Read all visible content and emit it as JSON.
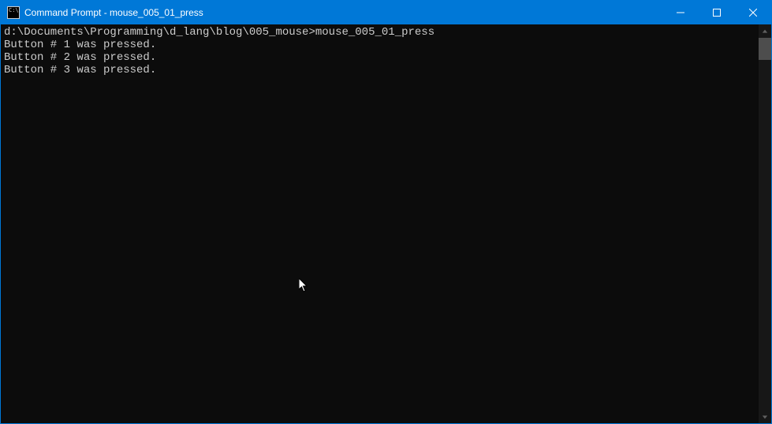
{
  "window": {
    "title": "Command Prompt - mouse_005_01_press",
    "icon_text": "C:\\"
  },
  "controls": {
    "minimize": "minimize",
    "maximize": "maximize",
    "close": "close"
  },
  "terminal": {
    "prompt_path": "d:\\Documents\\Programming\\d_lang\\blog\\005_mouse>",
    "command": "mouse_005_01_press",
    "lines": [
      "Button # 1 was pressed.",
      "Button # 2 was pressed.",
      "Button # 3 was pressed."
    ]
  }
}
